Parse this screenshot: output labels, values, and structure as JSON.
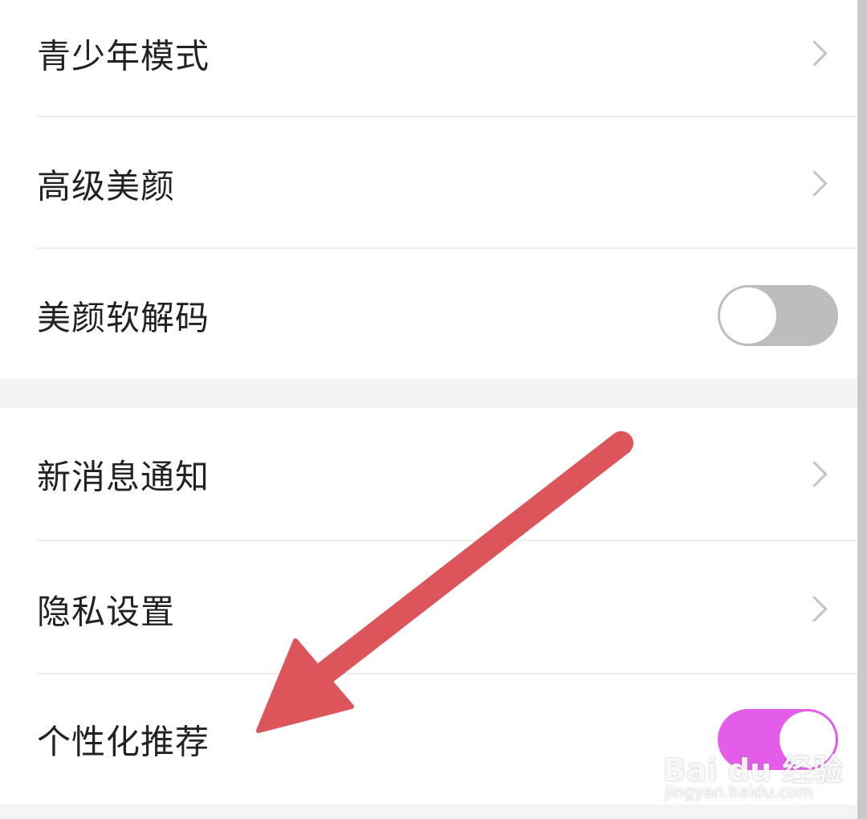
{
  "groups": [
    {
      "items": [
        {
          "label": "青少年模式",
          "control": "chevron"
        },
        {
          "label": "高级美颜",
          "control": "chevron"
        },
        {
          "label": "美颜软解码",
          "control": "toggle",
          "toggle_on": false
        }
      ]
    },
    {
      "items": [
        {
          "label": "新消息通知",
          "control": "chevron"
        },
        {
          "label": "隐私设置",
          "control": "chevron"
        },
        {
          "label": "个性化推荐",
          "control": "toggle",
          "toggle_on": true
        }
      ]
    }
  ],
  "colors": {
    "toggle_on": "#e45de8",
    "toggle_off": "#bdbdbd",
    "arrow": "#dc555b",
    "background": "#f3f4f6"
  },
  "watermark": {
    "logo_text": "Bai du 经验",
    "url_text": "jingyan.baidu.com"
  }
}
